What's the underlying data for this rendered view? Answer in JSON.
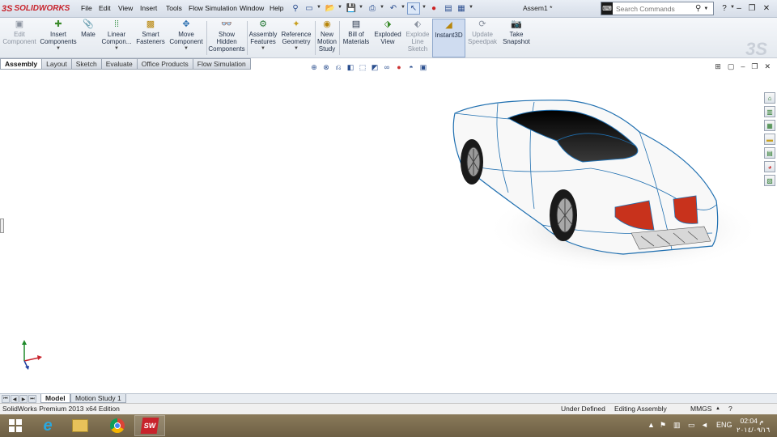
{
  "app": {
    "brand": "SOLIDWORKS",
    "doc_title": "Assem1 *"
  },
  "menu": [
    "File",
    "Edit",
    "View",
    "Insert",
    "Tools",
    "Flow Simulation",
    "Window",
    "Help"
  ],
  "search": {
    "placeholder": "Search Commands"
  },
  "commands": [
    {
      "label": "Edit Component",
      "icon": "edit-component-icon",
      "disabled": true
    },
    {
      "label": "Insert Components",
      "icon": "insert-components-icon"
    },
    {
      "label": "Mate",
      "icon": "mate-icon"
    },
    {
      "label": "Linear Compon...",
      "icon": "linear-pattern-icon"
    },
    {
      "label": "Smart Fasteners",
      "icon": "smart-fasteners-icon"
    },
    {
      "label": "Move Component",
      "icon": "move-component-icon"
    },
    {
      "label": "Show Hidden Components",
      "icon": "show-hidden-icon"
    },
    {
      "label": "Assembly Features",
      "icon": "assembly-features-icon"
    },
    {
      "label": "Reference Geometry",
      "icon": "reference-geometry-icon"
    },
    {
      "label": "New Motion Study",
      "icon": "motion-study-icon"
    },
    {
      "label": "Bill of Materials",
      "icon": "bom-icon"
    },
    {
      "label": "Exploded View",
      "icon": "exploded-view-icon"
    },
    {
      "label": "Explode Line Sketch",
      "icon": "explode-line-icon",
      "disabled": true
    },
    {
      "label": "Instant3D",
      "icon": "instant3d-icon",
      "active": true
    },
    {
      "label": "Update Speedpak",
      "icon": "speedpak-icon",
      "disabled": true
    },
    {
      "label": "Take Snapshot",
      "icon": "snapshot-icon"
    }
  ],
  "tabs": [
    "Assembly",
    "Layout",
    "Sketch",
    "Evaluate",
    "Office Products",
    "Flow Simulation"
  ],
  "bottom_tabs": [
    "Model",
    "Motion Study 1"
  ],
  "status": {
    "edition": "SolidWorks Premium 2013 x64 Edition",
    "state": "Under Defined",
    "mode": "Editing Assembly",
    "units": "MMGS"
  },
  "tray": {
    "lang": "ENG",
    "time": "02:04 م",
    "date": "٢٠١٤/٠٩/١٦"
  },
  "colors": {
    "accent_red": "#c8232c",
    "selection_blue": "#1f6fb0"
  }
}
